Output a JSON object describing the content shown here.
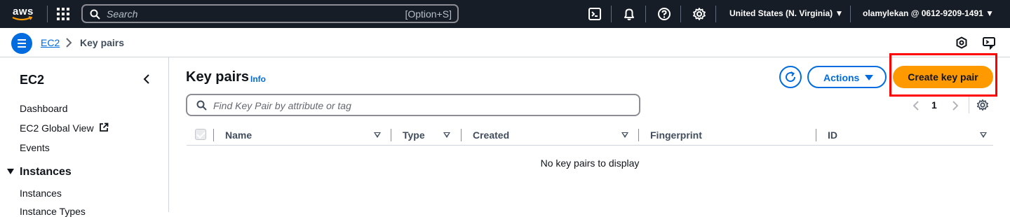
{
  "topnav": {
    "logo": "aws",
    "search_placeholder": "Search",
    "search_shortcut": "[Option+S]",
    "region": "United States (N. Virginia)",
    "account": "olamylekan @ 0612-9209-1491",
    "icons": [
      "cloudshell-icon",
      "bell-icon",
      "help-icon",
      "gear-icon"
    ]
  },
  "breadcrumb": {
    "root": "EC2",
    "current": "Key pairs"
  },
  "sidebar": {
    "title": "EC2",
    "links": [
      "Dashboard",
      "EC2 Global View",
      "Events"
    ],
    "section": "Instances",
    "section_links": [
      "Instances",
      "Instance Types"
    ]
  },
  "main": {
    "title": "Key pairs",
    "info": "Info",
    "actions_label": "Actions",
    "create_label": "Create key pair",
    "filter_placeholder": "Find Key Pair by attribute or tag",
    "page_number": "1",
    "columns": [
      "Name",
      "Type",
      "Created",
      "Fingerprint",
      "ID"
    ],
    "empty_message": "No key pairs to display"
  },
  "colors": {
    "nav_bg": "#161d26",
    "link_blue": "#006ce0",
    "primary_orange": "#ff9900",
    "highlight_red": "#ff0000"
  }
}
